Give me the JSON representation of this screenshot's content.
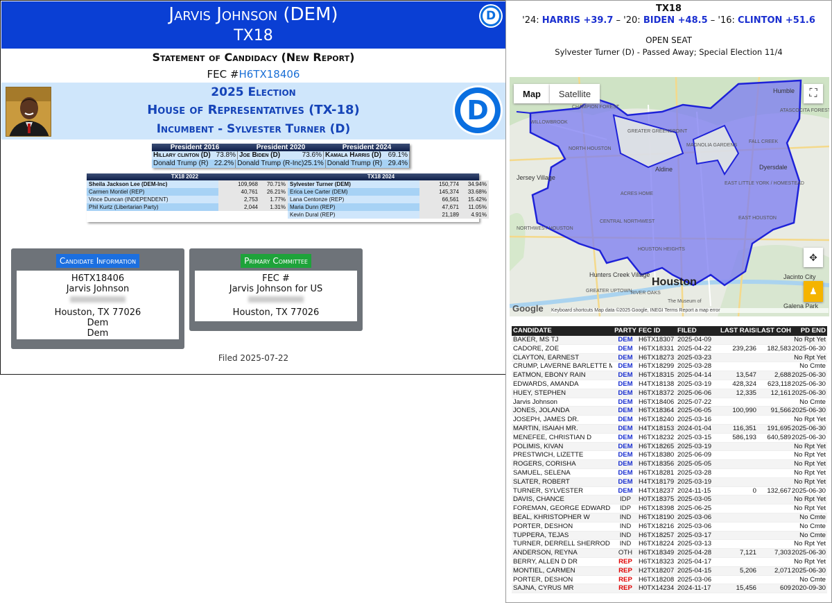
{
  "header": {
    "name": "Jarvis Johnson (DEM)",
    "district": "TX18"
  },
  "statement": {
    "title": "Statement of Candidacy (New Report)",
    "fec_prefix": "FEC #",
    "fec_id": "H6TX18406"
  },
  "election": {
    "year_title": "2025 Election",
    "office": "House of Representatives (TX-18)",
    "incumbent": "Incumbent - Sylvester Turner (D)"
  },
  "logo_letter": "D",
  "presidential": {
    "headers": [
      "President 2016",
      "President 2020",
      "President 2024"
    ],
    "rows": [
      [
        [
          "Hillary clinton (D)",
          "73.8%"
        ],
        [
          "Joe Biden (D)",
          "73.6%"
        ],
        [
          "Kamala Harris (D)",
          "69.1%"
        ]
      ],
      [
        [
          "Donald Trump (R)",
          "22.2%"
        ],
        [
          "Donald Trump (R-Inc)",
          "25.1%"
        ],
        [
          "Donald Trump (R)",
          "29.4%"
        ]
      ]
    ]
  },
  "history": {
    "headers": [
      "TX18 2022",
      "TX18 2024"
    ],
    "rows": [
      [
        [
          "Sheila Jackson Lee (DEM-Inc)",
          "109,968",
          "70.71%"
        ],
        [
          "Sylvester Turner (DEM)",
          "150,774",
          "34.94%"
        ]
      ],
      [
        [
          "Carmen Montiel (REP)",
          "40,761",
          "26.21%"
        ],
        [
          "Erica Lee Carter (DEM)",
          "145,374",
          "33.68%"
        ]
      ],
      [
        [
          "Vince Duncan (INDEPENDENT)",
          "2,753",
          "1.77%"
        ],
        [
          "Lana Centonze (REP)",
          "66,561",
          "15.42%"
        ]
      ],
      [
        [
          "Phil Kurtz (Libertarian Party)",
          "2,044",
          "1.31%"
        ],
        [
          "Maria Dunn (REP)",
          "47,671",
          "11.05%"
        ]
      ],
      [
        [
          "",
          "",
          ""
        ],
        [
          "Kevin Dural (REP)",
          "21,189",
          "4.91%"
        ]
      ]
    ]
  },
  "candidate_card": {
    "label": "Candidate Information",
    "id": "H6TX18406",
    "name": "Jarvis Johnson",
    "city": "Houston, TX 77026",
    "party1": "Dem",
    "party2": "Dem"
  },
  "committee_card": {
    "label": "Primary Committee",
    "line1": "FEC #",
    "name": "Jarvis Johnson for US",
    "city": "Houston, TX 77026"
  },
  "filed": "Filed 2025-07-22",
  "right": {
    "district": "TX18",
    "margins": {
      "p24": "'24:",
      "v24": "HARRIS +39.7",
      "sep1": " – '20:",
      "v20": "BIDEN +48.5",
      "sep2": " – '16:",
      "v16": "CLINTON +51.6"
    },
    "open_seat": "OPEN SEAT",
    "note": "Sylvester Turner (D) - Passed Away; Special Election 11/4"
  },
  "map": {
    "tab_map": "Map",
    "tab_sat": "Satellite",
    "city": "Houston",
    "google": "Google",
    "footer": "Keyboard shortcuts   Map data ©2025 Google, INEGI   Terms   Report a map error",
    "labels": [
      "CHAMPION FOREST",
      "WILLOWBROOK",
      "NORTH HOUSTON",
      "GREATER GREENSPOINT",
      "MAGNOLIA GARDENS",
      "Aldine",
      "Jersey Village",
      "ACRES HOME",
      "CENTRAL NORTHWEST",
      "NORTHWEST HOUSTON",
      "EAST LITTLE YORK / HOMESTEAD",
      "EAST HOUSTON",
      "Dyersdale",
      "FALL CREEK",
      "ATASCOCITA FOREST",
      "Humble",
      "HOUSTON HEIGHTS",
      "Hunters Creek Village",
      "RIVER OAKS",
      "GREATER UPTOWN",
      "Galena Park",
      "Jacinto City",
      "The Museum of"
    ],
    "colors": {
      "district": "#7b7bf2",
      "border": "#1e22d8"
    }
  },
  "candidates": {
    "headers": [
      "CANDIDATE",
      "PARTY",
      "FEC ID",
      "FILED",
      "LAST RAISED",
      "LAST COH",
      "PD END"
    ],
    "party_colors": {
      "DEM": "#1a2fd0",
      "REP": "#e00000",
      "IDP": "#222222",
      "IND": "#222222",
      "OTH": "#222222"
    },
    "rows": [
      [
        "BAKER, MS TJ",
        "DEM",
        "H6TX18307",
        "2025-04-09",
        "",
        "",
        "No Rpt Yet"
      ],
      [
        "CADORE, ZOE",
        "DEM",
        "H6TX18331",
        "2025-04-22",
        "239,236",
        "182,583",
        "2025-06-30"
      ],
      [
        "CLAYTON, EARNEST",
        "DEM",
        "H6TX18273",
        "2025-03-23",
        "",
        "",
        "No Rpt Yet"
      ],
      [
        "CRUMP, LAVERNE BARLETTE MS",
        "DEM",
        "H6TX18299",
        "2025-03-28",
        "",
        "",
        "No Cmte"
      ],
      [
        "EATMON, EBONY RAIN",
        "DEM",
        "H6TX18315",
        "2025-04-14",
        "13,547",
        "2,688",
        "2025-06-30"
      ],
      [
        "EDWARDS, AMANDA",
        "DEM",
        "H4TX18138",
        "2025-03-19",
        "428,324",
        "623,118",
        "2025-06-30"
      ],
      [
        "HUEY, STEPHEN",
        "DEM",
        "H6TX18372",
        "2025-06-06",
        "12,335",
        "12,161",
        "2025-06-30"
      ],
      [
        "Jarvis Johnson",
        "DEM",
        "H6TX18406",
        "2025-07-22",
        "",
        "",
        "No Cmte"
      ],
      [
        "JONES, JOLANDA",
        "DEM",
        "H6TX18364",
        "2025-06-05",
        "100,990",
        "91,566",
        "2025-06-30"
      ],
      [
        "JOSEPH, JAMES DR.",
        "DEM",
        "H6TX18240",
        "2025-03-16",
        "",
        "",
        "No Rpt Yet"
      ],
      [
        "MARTIN, ISAIAH MR.",
        "DEM",
        "H4TX18153",
        "2024-01-04",
        "116,351",
        "191,695",
        "2025-06-30"
      ],
      [
        "MENEFEE, CHRISTIAN D",
        "DEM",
        "H6TX18232",
        "2025-03-15",
        "586,193",
        "640,589",
        "2025-06-30"
      ],
      [
        "POLIMIS, KIVAN",
        "DEM",
        "H6TX18265",
        "2025-03-19",
        "",
        "",
        "No Rpt Yet"
      ],
      [
        "PRESTWICH, LIZETTE",
        "DEM",
        "H6TX18380",
        "2025-06-09",
        "",
        "",
        "No Rpt Yet"
      ],
      [
        "ROGERS, CORISHA",
        "DEM",
        "H6TX18356",
        "2025-05-05",
        "",
        "",
        "No Rpt Yet"
      ],
      [
        "SAMUEL, SELENA",
        "DEM",
        "H6TX18281",
        "2025-03-28",
        "",
        "",
        "No Rpt Yet"
      ],
      [
        "SLATER, ROBERT",
        "DEM",
        "H4TX18179",
        "2025-03-19",
        "",
        "",
        "No Rpt Yet"
      ],
      [
        "TURNER, SYLVESTER",
        "DEM",
        "H4TX18237",
        "2024-11-15",
        "0",
        "132,667",
        "2025-06-30"
      ],
      [
        "DAVIS, CHANCE",
        "IDP",
        "H0TX18375",
        "2025-03-05",
        "",
        "",
        "No Rpt Yet"
      ],
      [
        "FOREMAN, GEORGE EDWARD IV",
        "IDP",
        "H6TX18398",
        "2025-06-25",
        "",
        "",
        "No Rpt Yet"
      ],
      [
        "BEAL, KHRISTOPHER W",
        "IND",
        "H6TX18190",
        "2025-03-06",
        "",
        "",
        "No Cmte"
      ],
      [
        "PORTER, DESHON",
        "IND",
        "H6TX18216",
        "2025-03-06",
        "",
        "",
        "No Cmte"
      ],
      [
        "TUPPERA, TEJAS",
        "IND",
        "H6TX18257",
        "2025-03-17",
        "",
        "",
        "No Cmte"
      ],
      [
        "TURNER, DERRELL SHERROD",
        "IND",
        "H6TX18224",
        "2025-03-13",
        "",
        "",
        "No Rpt Yet"
      ],
      [
        "ANDERSON, REYNA",
        "OTH",
        "H6TX18349",
        "2025-04-28",
        "7,121",
        "7,303",
        "2025-06-30"
      ],
      [
        "BERRY, ALLEN D DR",
        "REP",
        "H6TX18323",
        "2025-04-17",
        "",
        "",
        "No Rpt Yet"
      ],
      [
        "MONTIEL, CARMEN",
        "REP",
        "H2TX18207",
        "2025-04-15",
        "5,206",
        "2,071",
        "2025-06-30"
      ],
      [
        "PORTER, DESHON",
        "REP",
        "H6TX18208",
        "2025-03-06",
        "",
        "",
        "No Cmte"
      ],
      [
        "SAJNA, CYRUS MR",
        "REP",
        "H0TX14234",
        "2024-11-17",
        "15,456",
        "609",
        "2020-09-30"
      ]
    ]
  }
}
